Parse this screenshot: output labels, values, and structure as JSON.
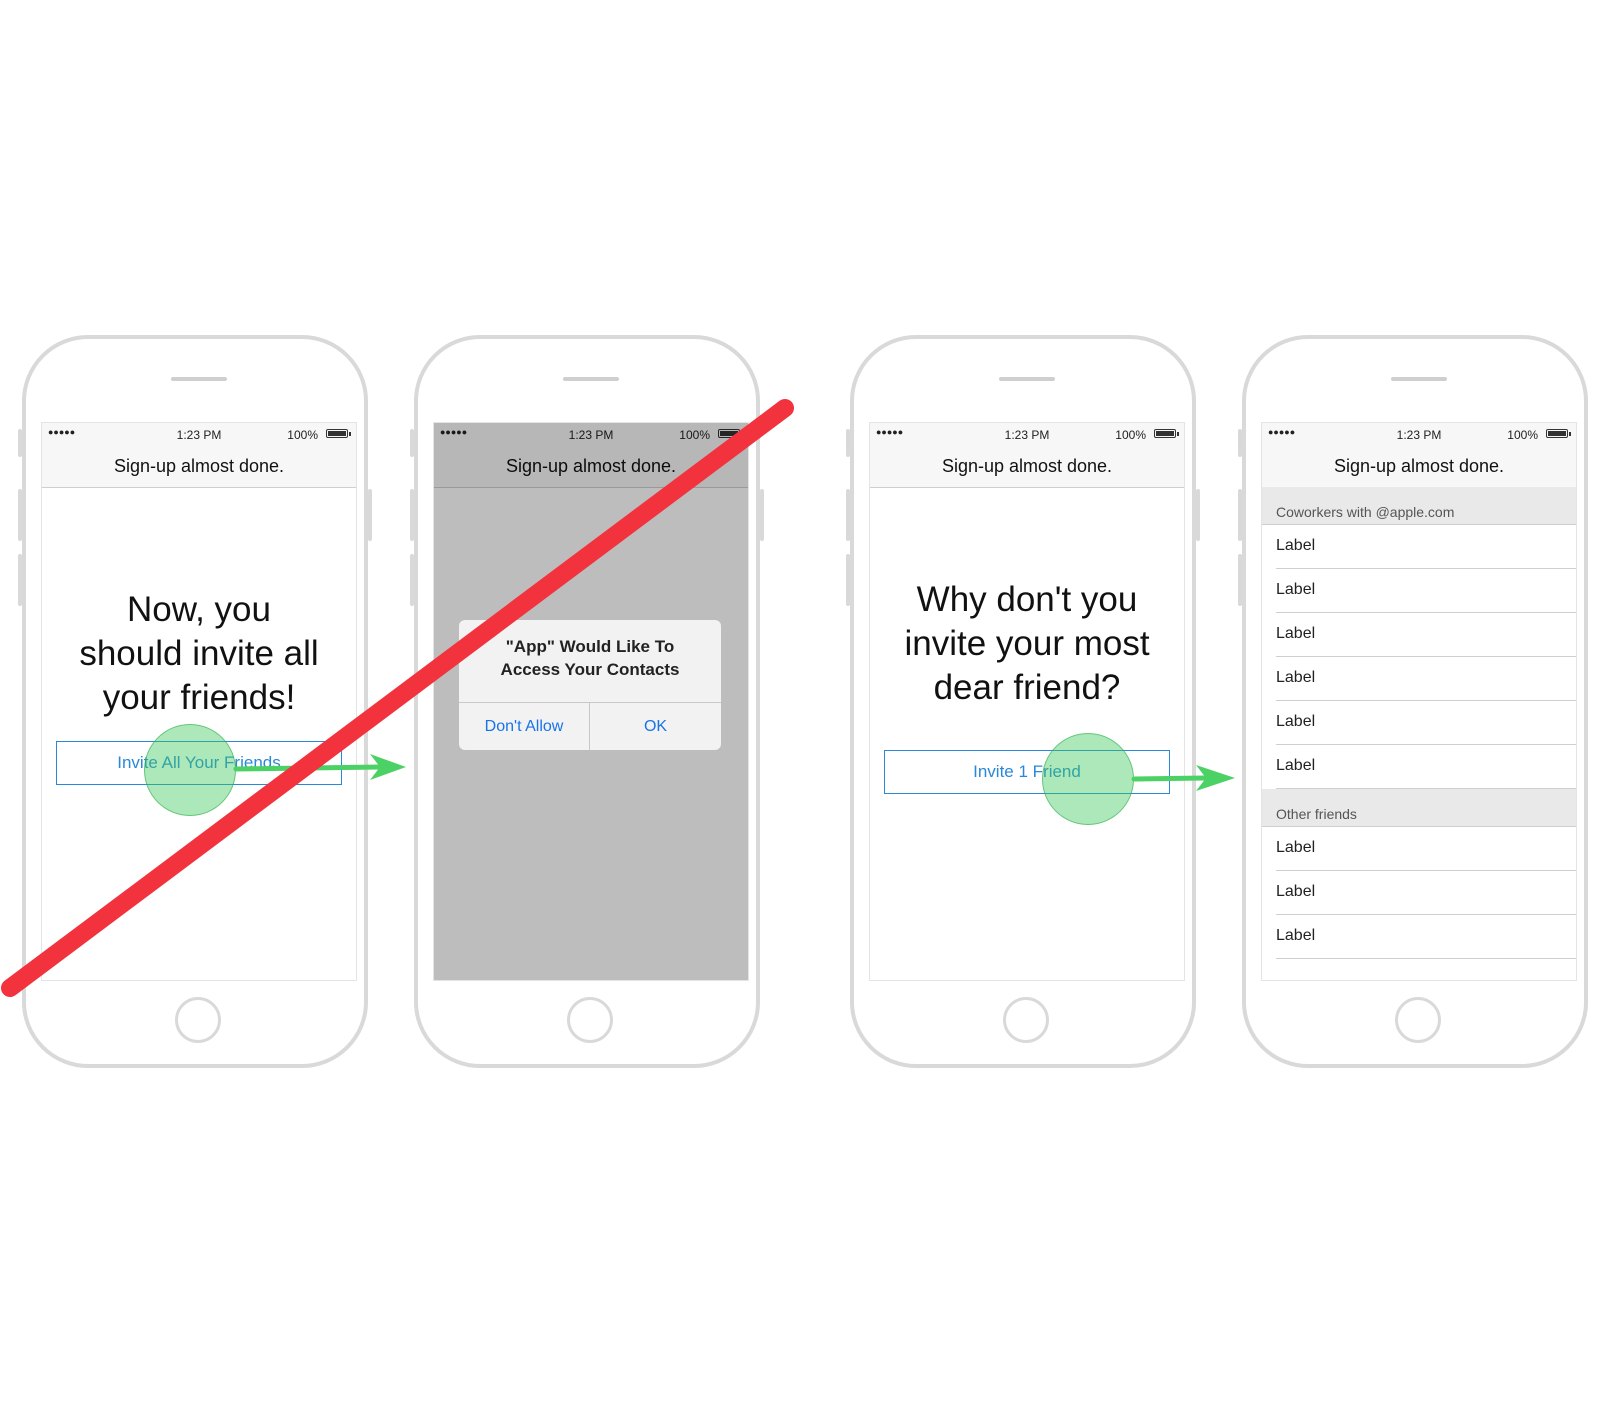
{
  "status_bar": {
    "signal": "●●●●●",
    "time": "1:23 PM",
    "battery": "100%"
  },
  "nav_title": "Sign-up almost done.",
  "screen1": {
    "headline_lines": [
      "Now, you",
      "should invite all",
      "your friends!"
    ],
    "cta_label": "Invite All Your Friends"
  },
  "screen2": {
    "alert_title_lines": [
      "\"App\" Would Like To",
      "Access Your Contacts"
    ],
    "dont_allow_label": "Don't Allow",
    "ok_label": "OK"
  },
  "screen3": {
    "headline_lines": [
      "Why don't you",
      "invite your most",
      "dear friend?"
    ],
    "cta_label": "Invite 1 Friend"
  },
  "screen4": {
    "section1_header": "Coworkers with @apple.com",
    "section1_rows": [
      "Label",
      "Label",
      "Label",
      "Label",
      "Label",
      "Label"
    ],
    "section2_header": "Other friends",
    "section2_rows": [
      "Label",
      "Label",
      "Label"
    ]
  },
  "colors": {
    "strike": "#f2323c",
    "arrow": "#4cd164",
    "tap_target": "#3cc85a",
    "link_blue": "#2a88d8"
  }
}
